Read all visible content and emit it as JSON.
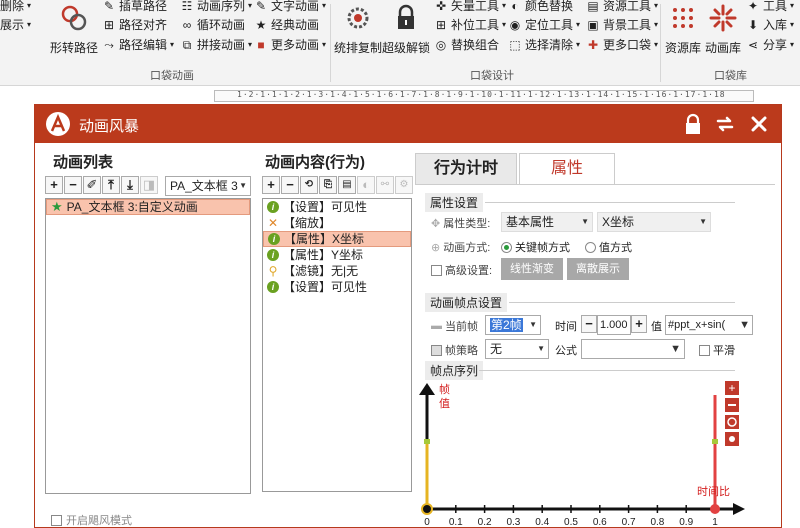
{
  "ribbon": {
    "col1": {
      "item1": "删除",
      "item2": "展示"
    },
    "col2": {
      "big_label": "形转路径"
    },
    "col3": {
      "item1": "插草路径",
      "item2": "路径对齐",
      "item3": "路径编辑"
    },
    "col4": {
      "item1": "动画序列",
      "item2": "循环动画",
      "item3": "拼接动画"
    },
    "col5": {
      "item1": "文字动画",
      "item2": "经典动画",
      "item3": "更多动画"
    },
    "group1_label": "口袋动画",
    "col6": {
      "big1": "统排复制",
      "big2": "超级解锁"
    },
    "col7": {
      "item1": "矢量工具",
      "item2": "补位工具",
      "item3": "替换组合"
    },
    "col8": {
      "item1": "颜色替换",
      "item2": "定位工具",
      "item3": "选择清除"
    },
    "col9": {
      "item1": "资源工具",
      "item2": "背景工具",
      "item3": "更多口袋"
    },
    "group2_label": "口袋设计",
    "col10": {
      "big1": "资源库",
      "big2": "动画库"
    },
    "col11": {
      "item1": "工具",
      "item2": "入库",
      "item3": "分享"
    },
    "group3_label": "口袋库"
  },
  "ruler": {
    "text": "1·2·1·1·1·2·1·3·1·4·1·5·1·6·1·7·1·8·1·9·1·10·1·11·1·12·1·13·1·14·1·15·1·16·1·17·1·18"
  },
  "dialog": {
    "title": "动画风暴",
    "anim_list": {
      "title": "动画列表",
      "combo_value": "PA_文本框 3",
      "items": [
        {
          "label": "PA_文本框 3:自定义动画"
        }
      ]
    },
    "anim_content": {
      "title": "动画内容(行为)",
      "items": [
        {
          "label": "【设置】可见性"
        },
        {
          "label": "【缩放】"
        },
        {
          "label": "【属性】X坐标"
        },
        {
          "label": "【属性】Y坐标"
        },
        {
          "label": "【滤镜】无|无"
        },
        {
          "label": "【设置】可见性"
        }
      ]
    },
    "tabs": {
      "timing": "行为计时",
      "props": "属性"
    },
    "props": {
      "section1": "属性设置",
      "prop_type_label": "属性类型:",
      "prop_type_value": "基本属性",
      "prop_attr_value": "X坐标",
      "anim_mode_label": "动画方式:",
      "mode_keyframe": "关键帧方式",
      "mode_value": "值方式",
      "advanced_label": "高级设置:",
      "btn_linear": "线性渐变",
      "btn_discrete": "离散展示",
      "section2": "动画帧点设置",
      "current_frame_label": "当前帧",
      "current_frame_value": "第2帧",
      "time_label": "时间",
      "time_value": "1.000",
      "value_label": "值",
      "value_value": "#ppt_x+sin(",
      "frame_strategy_label": "帧策略",
      "frame_strategy_value": "无",
      "formula_label": "公式",
      "smooth_label": "平滑",
      "section3": "帧点序列"
    },
    "timeline": {
      "y_label": "帧值",
      "x_label": "时间比",
      "ticks": [
        "0",
        "0.1",
        "0.2",
        "0.3",
        "0.4",
        "0.5",
        "0.6",
        "0.7",
        "0.8",
        "0.9",
        "1"
      ]
    },
    "footer_checkbox": "开启飓风模式"
  }
}
